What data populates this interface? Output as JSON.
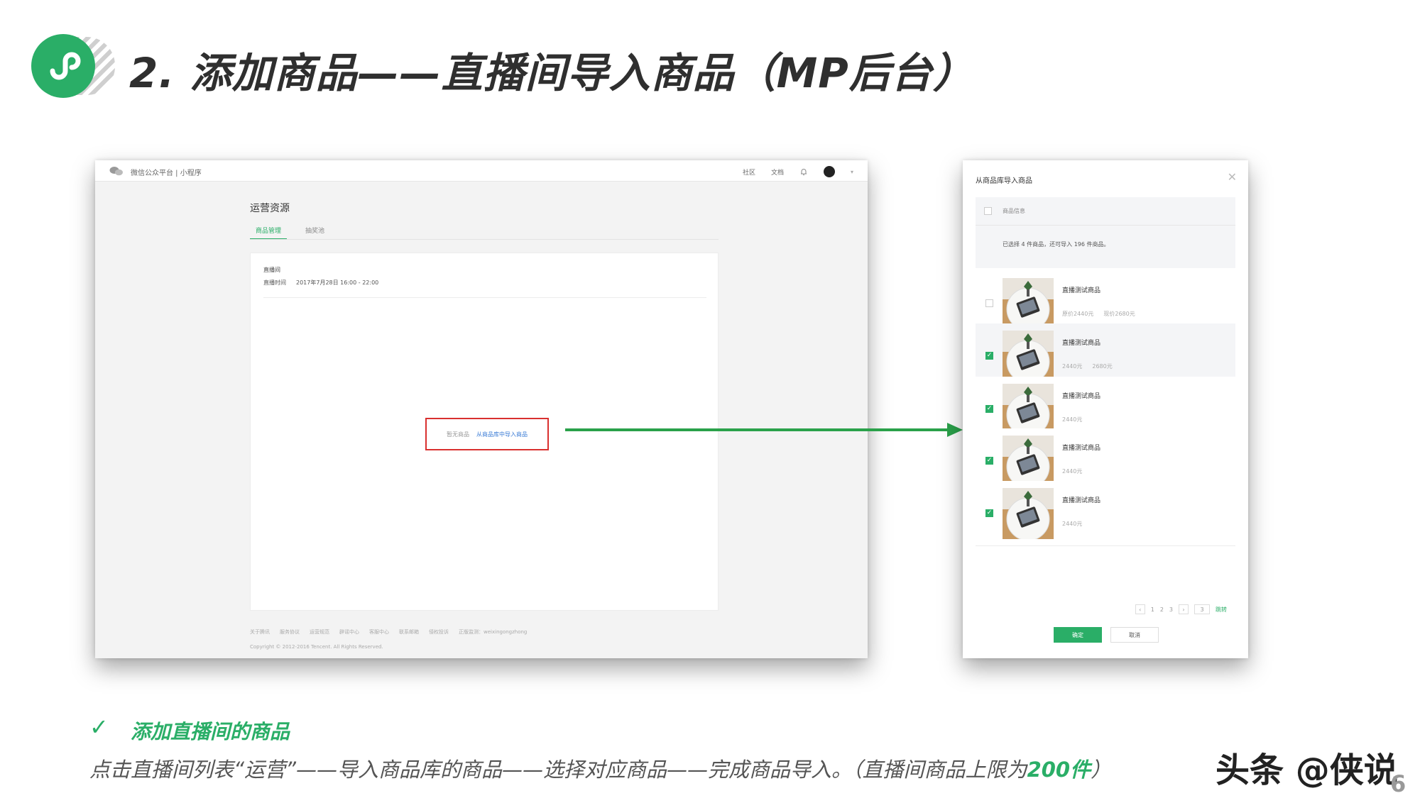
{
  "slide": {
    "title": "2. 添加商品——直播间导入商品（MP后台）",
    "logo_icon": "mini-program-logo",
    "sub_heading": "添加直播间的商品",
    "description_main": "点击直播间列表“运营”——导入商品库的商品——选择对应商品——完成商品导入。（直播间商品上限为",
    "description_limit": "200件",
    "description_end": "）",
    "watermark": "头条 @侠说",
    "page_number": "6",
    "accent_color": "#2aae67"
  },
  "mp_console": {
    "brand": "微信公众平台 | 小程序",
    "nav": [
      "社区",
      "文档"
    ],
    "page_title": "运营资源",
    "tabs": [
      "商品管理",
      "抽奖池"
    ],
    "card": {
      "label": "直播间",
      "time_label": "直播时间",
      "time_value": "2017年7月28日 16:00 - 22:00",
      "empty_hint": "暂无商品",
      "import_link": "从商品库中导入商品"
    },
    "footer_links": [
      "关于腾讯",
      "服务协议",
      "运营规范",
      "辟谣中心",
      "客服中心",
      "联系邮箱",
      "侵权投诉",
      "正版监测：weixingongzhong"
    ],
    "copyright": "Copyright © 2012-2016 Tencent. All Rights Reserved."
  },
  "dialog": {
    "title": "从商品库导入商品",
    "header_label": "商品信息",
    "selected_text": "已选择 4 件商品，还可导入 196 件商品。",
    "products": [
      {
        "name": "直播测试商品",
        "price": "原价2440元",
        "price2": "现价2680元",
        "checked": false,
        "highlight": false
      },
      {
        "name": "直播测试商品",
        "price": "2440元",
        "price2": "2680元",
        "checked": true,
        "highlight": true
      },
      {
        "name": "直播测试商品",
        "price": "2440元",
        "price2": "",
        "checked": true,
        "highlight": false
      },
      {
        "name": "直播测试商品",
        "price": "2440元",
        "price2": "",
        "checked": true,
        "highlight": false
      },
      {
        "name": "直播测试商品",
        "price": "2440元",
        "price2": "",
        "checked": true,
        "highlight": false
      }
    ],
    "pager": {
      "prev": "‹",
      "pages": [
        "1",
        "2",
        "3"
      ],
      "next": "›",
      "jump_value": "3",
      "jump_label": "跳转"
    },
    "confirm": "确定",
    "cancel": "取消"
  }
}
